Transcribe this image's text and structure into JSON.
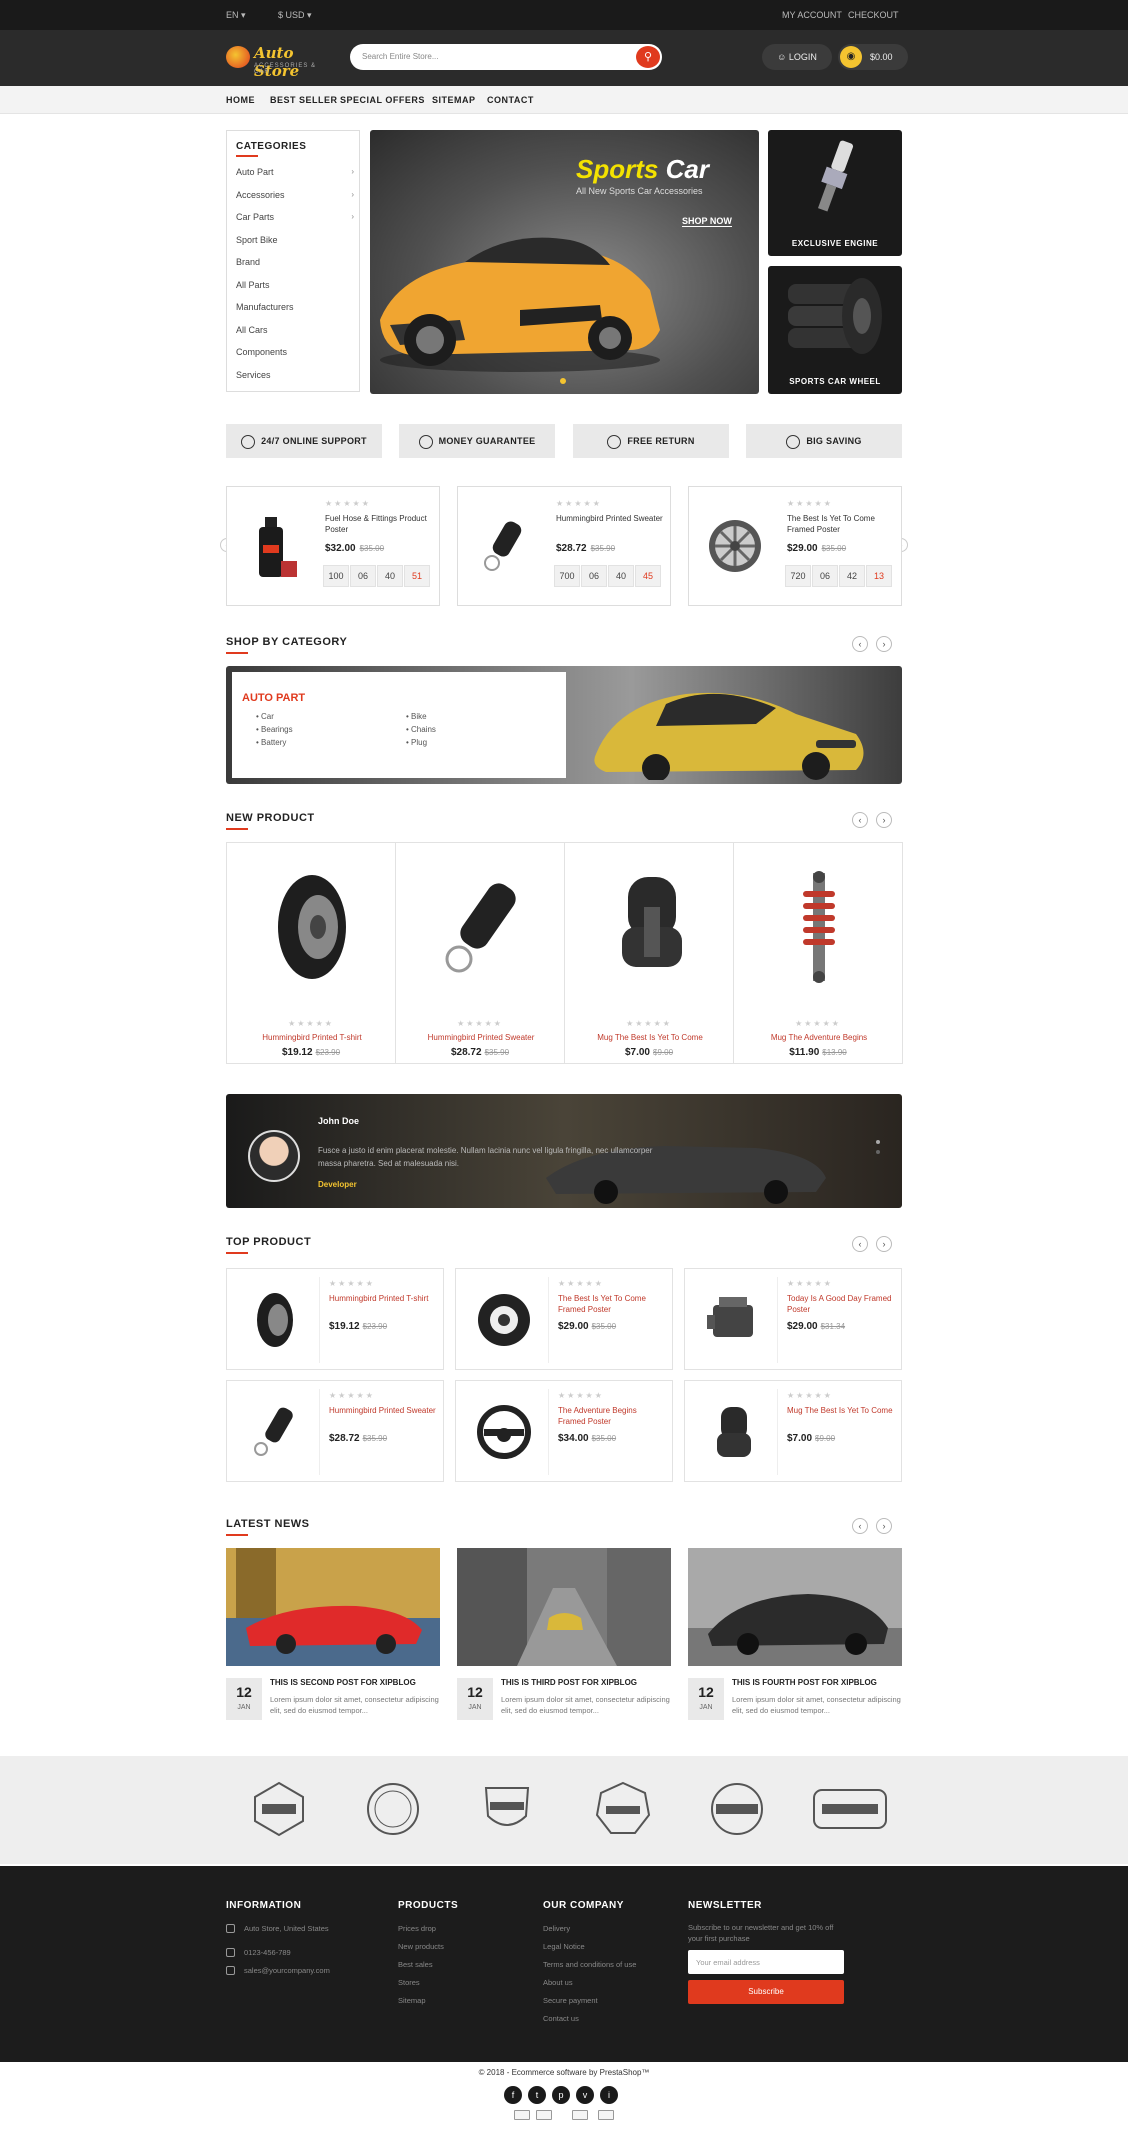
{
  "topbar": {
    "language": "EN ▾",
    "currency": "$ USD ▾",
    "account": "MY ACCOUNT",
    "checkout": "CHECKOUT"
  },
  "header": {
    "logo_name": "Auto Store",
    "logo_tagline": "ACCESSORIES & CAR",
    "search_placeholder": "Search Entire Store...",
    "login_label": "LOGIN",
    "cart_amount": "$0.00"
  },
  "nav": [
    "HOME",
    "BEST SELLER",
    "SPECIAL OFFERS",
    "SITEMAP",
    "CONTACT"
  ],
  "categories": {
    "title": "CATEGORIES",
    "items": [
      {
        "label": "Auto Part",
        "has_sub": true
      },
      {
        "label": "Accessories",
        "has_sub": true
      },
      {
        "label": "Car Parts",
        "has_sub": true
      },
      {
        "label": "Sport Bike",
        "has_sub": false
      },
      {
        "label": "Brand",
        "has_sub": false
      },
      {
        "label": "All Parts",
        "has_sub": false
      },
      {
        "label": "Manufacturers",
        "has_sub": false
      },
      {
        "label": "All Cars",
        "has_sub": false
      },
      {
        "label": "Components",
        "has_sub": false
      },
      {
        "label": "Services",
        "has_sub": false
      }
    ]
  },
  "hero": {
    "title_word1": "Sports",
    "title_word2": "Car",
    "subtitle": "All New Sports Car Accessories",
    "cta": "SHOP NOW"
  },
  "side_banners": [
    "EXCLUSIVE ENGINE",
    "SPORTS CAR WHEEL"
  ],
  "services": [
    "24/7 ONLINE SUPPORT",
    "MONEY GUARANTEE",
    "FREE RETURN",
    "BIG SAVING"
  ],
  "deals": [
    {
      "name": "Fuel Hose & Fittings Product Poster",
      "price": "$32.00",
      "old": "$35.00",
      "countdown": [
        "100",
        "06",
        "40",
        "51"
      ]
    },
    {
      "name": "Hummingbird Printed Sweater",
      "price": "$28.72",
      "old": "$35.90",
      "countdown": [
        "700",
        "06",
        "40",
        "45"
      ]
    },
    {
      "name": "The Best Is Yet To Come Framed Poster",
      "price": "$29.00",
      "old": "$35.00",
      "countdown": [
        "720",
        "06",
        "42",
        "13"
      ]
    }
  ],
  "shop_by_category": {
    "title": "SHOP BY CATEGORY",
    "panel_title": "AUTO PART",
    "col1": [
      "Car",
      "Bearings",
      "Battery"
    ],
    "col2": [
      "Bike",
      "Chains",
      "Plug"
    ]
  },
  "new_product": {
    "title": "NEW PRODUCT",
    "items": [
      {
        "name": "Hummingbird Printed T-shirt",
        "price": "$19.12",
        "old": "$23.90"
      },
      {
        "name": "Hummingbird Printed Sweater",
        "price": "$28.72",
        "old": "$35.90"
      },
      {
        "name": "Mug The Best Is Yet To Come",
        "price": "$7.00",
        "old": "$9.00"
      },
      {
        "name": "Mug The Adventure Begins",
        "price": "$11.90",
        "old": "$13.90"
      }
    ]
  },
  "testimonial": {
    "name": "John Doe",
    "text": "Fusce a justo id enim placerat molestie. Nullam lacinia nunc vel ligula fringilla, nec ullamcorper massa pharetra. Sed at malesuada nisi.",
    "role": "Developer"
  },
  "top_product": {
    "title": "TOP PRODUCT",
    "items": [
      {
        "name": "Hummingbird Printed T-shirt",
        "price": "$19.12",
        "old": "$23.90"
      },
      {
        "name": "The Best Is Yet To Come Framed Poster",
        "price": "$29.00",
        "old": "$35.00"
      },
      {
        "name": "Today Is A Good Day Framed Poster",
        "price": "$29.00",
        "old": "$31.34"
      },
      {
        "name": "Hummingbird Printed Sweater",
        "price": "$28.72",
        "old": "$35.90"
      },
      {
        "name": "The Adventure Begins Framed Poster",
        "price": "$34.00",
        "old": "$35.00"
      },
      {
        "name": "Mug The Best Is Yet To Come",
        "price": "$7.00",
        "old": "$9.00"
      }
    ]
  },
  "latest_news": {
    "title": "LATEST NEWS",
    "items": [
      {
        "day": "12",
        "month": "JAN",
        "title": "THIS IS SECOND POST FOR XIPBLOG",
        "excerpt": "Lorem ipsum dolor sit amet, consectetur adipiscing elit, sed do eiusmod tempor..."
      },
      {
        "day": "12",
        "month": "JAN",
        "title": "THIS IS THIRD POST FOR XIPBLOG",
        "excerpt": "Lorem ipsum dolor sit amet, consectetur adipiscing elit, sed do eiusmod tempor..."
      },
      {
        "day": "12",
        "month": "JAN",
        "title": "THIS IS FOURTH POST FOR XIPBLOG",
        "excerpt": "Lorem ipsum dolor sit amet, consectetur adipiscing elit, sed do eiusmod tempor..."
      }
    ]
  },
  "footer": {
    "information_title": "INFORMATION",
    "info": [
      "Auto Store, United States",
      "0123-456-789",
      "sales@yourcompany.com"
    ],
    "products_title": "PRODUCTS",
    "products": [
      "Prices drop",
      "New products",
      "Best sales",
      "Stores",
      "Sitemap"
    ],
    "company_title": "OUR COMPANY",
    "company": [
      "Delivery",
      "Legal Notice",
      "Terms and conditions of use",
      "About us",
      "Secure payment",
      "Contact us"
    ],
    "newsletter_title": "NEWSLETTER",
    "newsletter_text": "Subscribe to our newsletter and get 10% off your first purchase",
    "email_placeholder": "Your email address",
    "subscribe": "Subscribe"
  },
  "copyright": "© 2018 - Ecommerce software by PrestaShop™",
  "social": [
    "f",
    "t",
    "p",
    "v",
    "i"
  ],
  "colors": {
    "accent": "#e03a1e",
    "brand_yellow": "#f4c430",
    "dark": "#1a1a1a"
  }
}
